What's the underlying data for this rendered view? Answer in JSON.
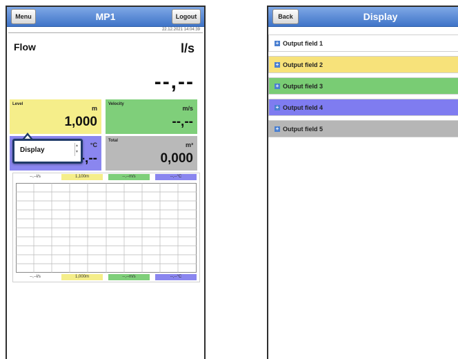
{
  "screen1": {
    "menu_label": "Menu",
    "title": "MP1",
    "logout_label": "Logout",
    "timestamp": "22.12.2021 14:04:39",
    "flow": {
      "label": "Flow",
      "unit": "l/s",
      "value": "--,--"
    },
    "tiles": [
      {
        "label": "Level",
        "unit": "m",
        "value": "1,000",
        "color": "#f5ee8a"
      },
      {
        "label": "Velocity",
        "unit": "m/s",
        "value": "--,--",
        "color": "#7fcf7a"
      },
      {
        "label": "",
        "unit": "°C",
        "value": "-,--",
        "color": "#8a86ef"
      },
      {
        "label": "Total",
        "unit": "m³",
        "value": "0,000",
        "color": "#b9b9b9"
      }
    ],
    "popup": {
      "label": "Display"
    },
    "chart_top_chips": [
      "--,--l/s",
      "1,100m",
      "--,--m/s",
      "--,--°C"
    ],
    "chart_bottom_chips": [
      "--,--l/s",
      "1,000m",
      "--,--m/s",
      "--,--°C"
    ]
  },
  "screen2": {
    "back_label": "Back",
    "title": "Display",
    "rows": [
      {
        "label": "Output field 1",
        "color": "#ffffff"
      },
      {
        "label": "Output field 2",
        "color": "#f7e27a"
      },
      {
        "label": "Output field 3",
        "color": "#79cc74"
      },
      {
        "label": "Output field 4",
        "color": "#7f7cf0"
      },
      {
        "label": "Output field 5",
        "color": "#b6b6b6"
      }
    ]
  },
  "colors": {
    "header_blue": "#4f82d2",
    "chip_white": "#ffffff",
    "chip_yellow": "#f5ee8a",
    "chip_green": "#7fcf7a",
    "chip_violet": "#8a86ef"
  }
}
